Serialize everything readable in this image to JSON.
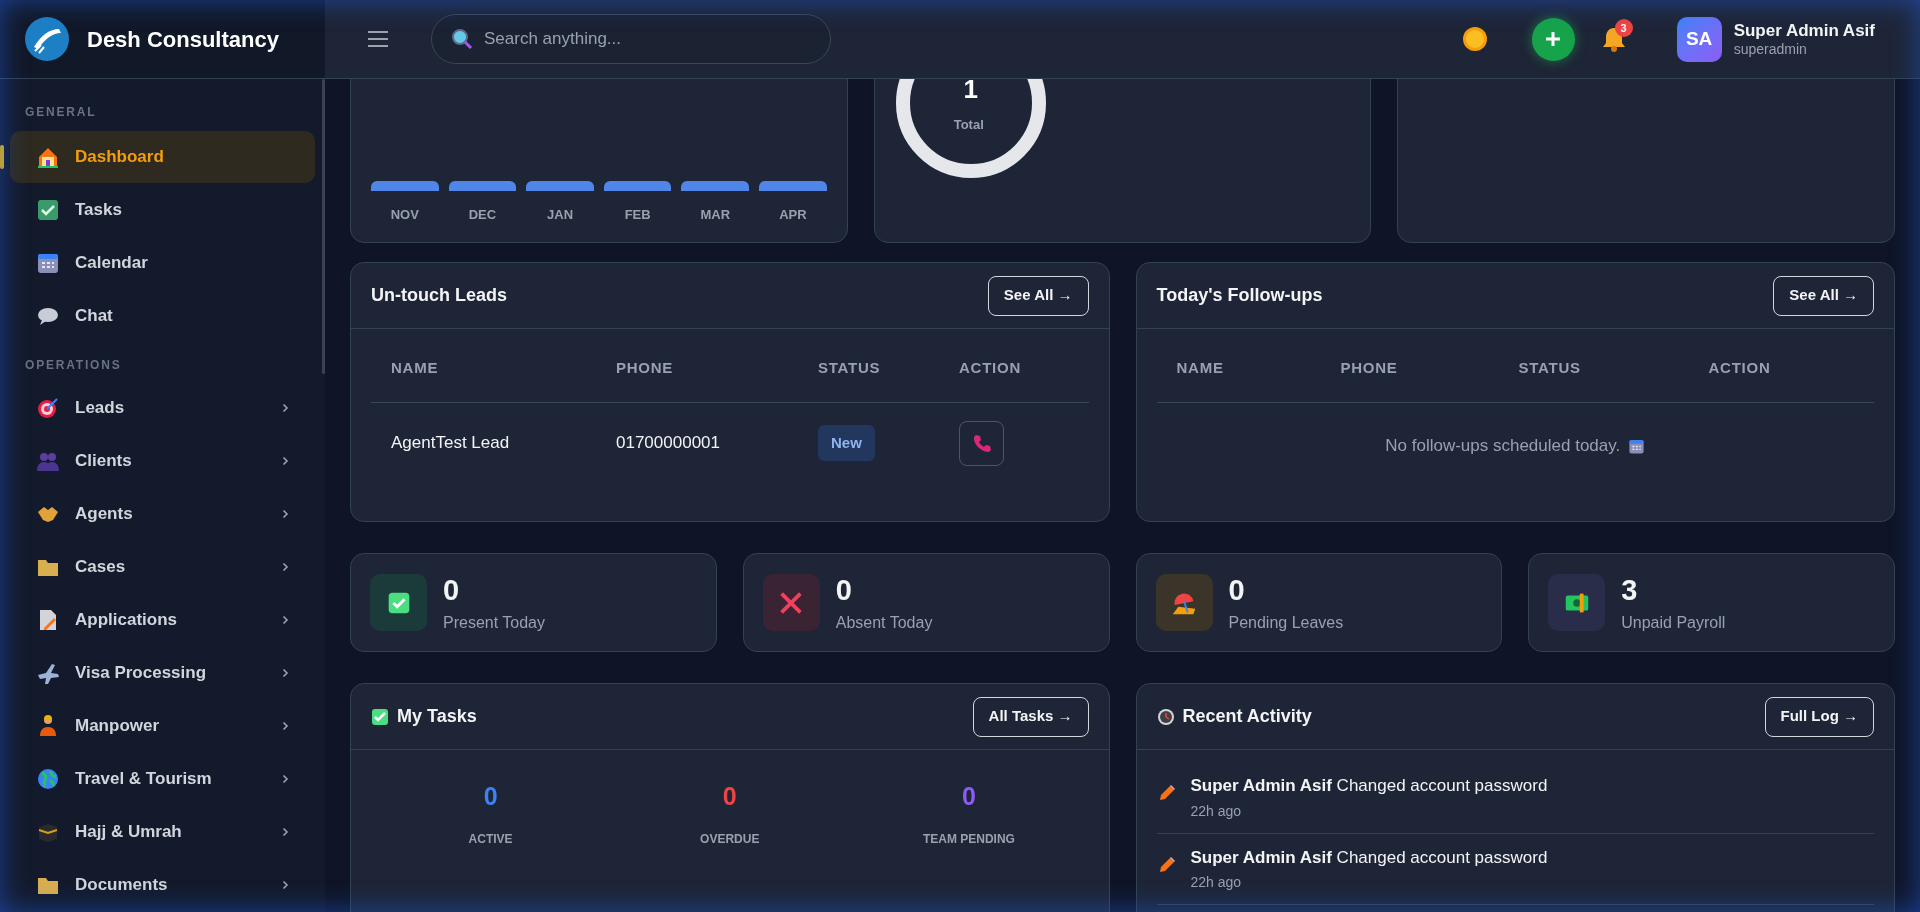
{
  "brand": {
    "name": "Desh Consultancy"
  },
  "search": {
    "placeholder": "Search anything..."
  },
  "notifications": {
    "count": "3"
  },
  "user": {
    "initials": "SA",
    "name": "Super Admin Asif",
    "role": "superadmin"
  },
  "sidebar": {
    "sections": [
      {
        "title": "GENERAL",
        "items": [
          {
            "label": "Dashboard",
            "selected": true,
            "expandable": false
          },
          {
            "label": "Tasks",
            "selected": false,
            "expandable": false
          },
          {
            "label": "Calendar",
            "selected": false,
            "expandable": false
          },
          {
            "label": "Chat",
            "selected": false,
            "expandable": false
          }
        ]
      },
      {
        "title": "OPERATIONS",
        "items": [
          {
            "label": "Leads",
            "selected": false,
            "expandable": true
          },
          {
            "label": "Clients",
            "selected": false,
            "expandable": true
          },
          {
            "label": "Agents",
            "selected": false,
            "expandable": true
          },
          {
            "label": "Cases",
            "selected": false,
            "expandable": true
          },
          {
            "label": "Applications",
            "selected": false,
            "expandable": true
          },
          {
            "label": "Visa Processing",
            "selected": false,
            "expandable": true
          },
          {
            "label": "Manpower",
            "selected": false,
            "expandable": true
          },
          {
            "label": "Travel & Tourism",
            "selected": false,
            "expandable": true
          },
          {
            "label": "Hajj & Umrah",
            "selected": false,
            "expandable": true
          },
          {
            "label": "Documents",
            "selected": false,
            "expandable": true
          }
        ]
      }
    ]
  },
  "monthly_chart": {
    "months": [
      "NOV",
      "DEC",
      "JAN",
      "FEB",
      "MAR",
      "APR"
    ]
  },
  "donut": {
    "value": "1",
    "label": "Total"
  },
  "untouched_leads": {
    "title": "Un-touch Leads",
    "button": "See All →",
    "columns": [
      "NAME",
      "PHONE",
      "STATUS",
      "ACTION"
    ],
    "rows": [
      {
        "name": "AgentTest Lead",
        "phone": "01700000001",
        "status": "New"
      }
    ]
  },
  "followups": {
    "title": "Today's Follow-ups",
    "button": "See All →",
    "columns": [
      "NAME",
      "PHONE",
      "STATUS",
      "ACTION"
    ],
    "empty_message": "No follow-ups scheduled today."
  },
  "stats": [
    {
      "value": "0",
      "label": "Present Today"
    },
    {
      "value": "0",
      "label": "Absent Today"
    },
    {
      "value": "0",
      "label": "Pending Leaves"
    },
    {
      "value": "3",
      "label": "Unpaid Payroll"
    }
  ],
  "my_tasks": {
    "title": "My Tasks",
    "button": "All Tasks →",
    "counters": [
      {
        "value": "0",
        "label": "ACTIVE",
        "color": "#3b82f6"
      },
      {
        "value": "0",
        "label": "OVERDUE",
        "color": "#ef4444"
      },
      {
        "value": "0",
        "label": "TEAM PENDING",
        "color": "#8b5cf6"
      }
    ]
  },
  "recent_activity": {
    "title": "Recent Activity",
    "button": "Full Log →",
    "entries": [
      {
        "text": "**Super Admin Asif** Changed account password",
        "time": "22h ago"
      },
      {
        "text": "**Super Admin Asif** Changed account password",
        "time": "22h ago"
      }
    ]
  }
}
